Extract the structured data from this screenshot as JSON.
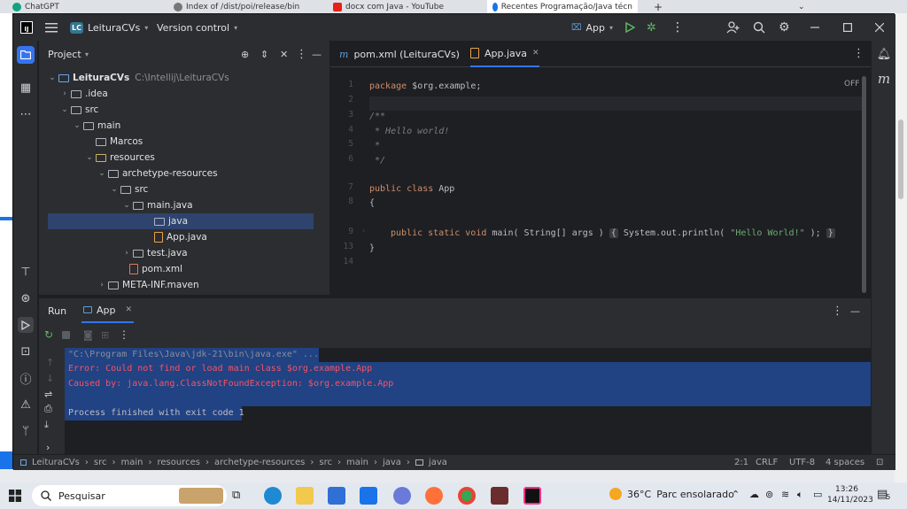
{
  "browser": {
    "tabs": [
      {
        "label": "ChatGPT"
      },
      {
        "label": "Index of /dist/poi/release/bin"
      },
      {
        "label": "docx com Java - YouTube"
      },
      {
        "label": "Recentes Programação/Java técn"
      }
    ],
    "new_tab": "+",
    "chevron": "⌄"
  },
  "titlebar": {
    "project_badge": "LC",
    "project_name": "LeituraCVs",
    "vcs": "Version control",
    "run_config": "App"
  },
  "project_panel": {
    "title": "Project",
    "tree": [
      {
        "label": "LeituraCVs",
        "hint": "C:\\Intellij\\LeituraCVs"
      },
      {
        "label": ".idea"
      },
      {
        "label": "src"
      },
      {
        "label": "main"
      },
      {
        "label": "Marcos"
      },
      {
        "label": "resources"
      },
      {
        "label": "archetype-resources"
      },
      {
        "label": "src"
      },
      {
        "label": "main.java"
      },
      {
        "label": "java"
      },
      {
        "label": "App.java"
      },
      {
        "label": "test.java"
      },
      {
        "label": "pom.xml"
      },
      {
        "label": "META-INF.maven"
      }
    ]
  },
  "editor": {
    "tabs": [
      {
        "label": "pom.xml (LeituraCVs)"
      },
      {
        "label": "App.java"
      }
    ],
    "off_badge": "OFF",
    "line_numbers": [
      "1",
      "2",
      "3",
      "4",
      "5",
      "6",
      "7",
      "8",
      "9",
      "13",
      "14"
    ],
    "lines": {
      "l1_kw": "package",
      "l1_rest": " $org.example;",
      "l3": "/**",
      "l4": " * Hello world!",
      "l5": " *",
      "l6": " */",
      "l7_kw": "public class",
      "l7_rest": " App",
      "l8": "{",
      "l9_kw": "public static void",
      "l9_a": " main( String[] args ) ",
      "l9_b": "{",
      "l9_c": " System.out.println( ",
      "l9_str": "\"Hello World!\"",
      "l9_d": " ); ",
      "l9_e": "}",
      "l13": "}"
    }
  },
  "run_panel": {
    "tab_run": "Run",
    "tab_app": "App",
    "console": [
      "\"C:\\Program Files\\Java\\jdk-21\\bin\\java.exe\" ...",
      "Error: Could not find or load main class $org.example.App",
      "Caused by: java.lang.ClassNotFoundException: $org.example.App",
      "",
      "Process finished with exit code 1"
    ]
  },
  "statusbar": {
    "breadcrumbs": [
      "LeituraCVs",
      "src",
      "main",
      "resources",
      "archetype-resources",
      "src",
      "main",
      "java",
      "java"
    ],
    "position": "2:1",
    "line_sep": "CRLF",
    "encoding": "UTF-8",
    "indent": "4 spaces"
  },
  "taskbar": {
    "search": "Pesquisar",
    "temperature": "36°C",
    "weather": "Parc ensolarado",
    "time": "13:26",
    "date": "14/11/2023",
    "notifications": "5"
  },
  "colors": {
    "accent": "#3574f0",
    "selection": "#214283",
    "error": "#f75464",
    "keyword": "#cf8e6d",
    "string": "#6aab73"
  }
}
